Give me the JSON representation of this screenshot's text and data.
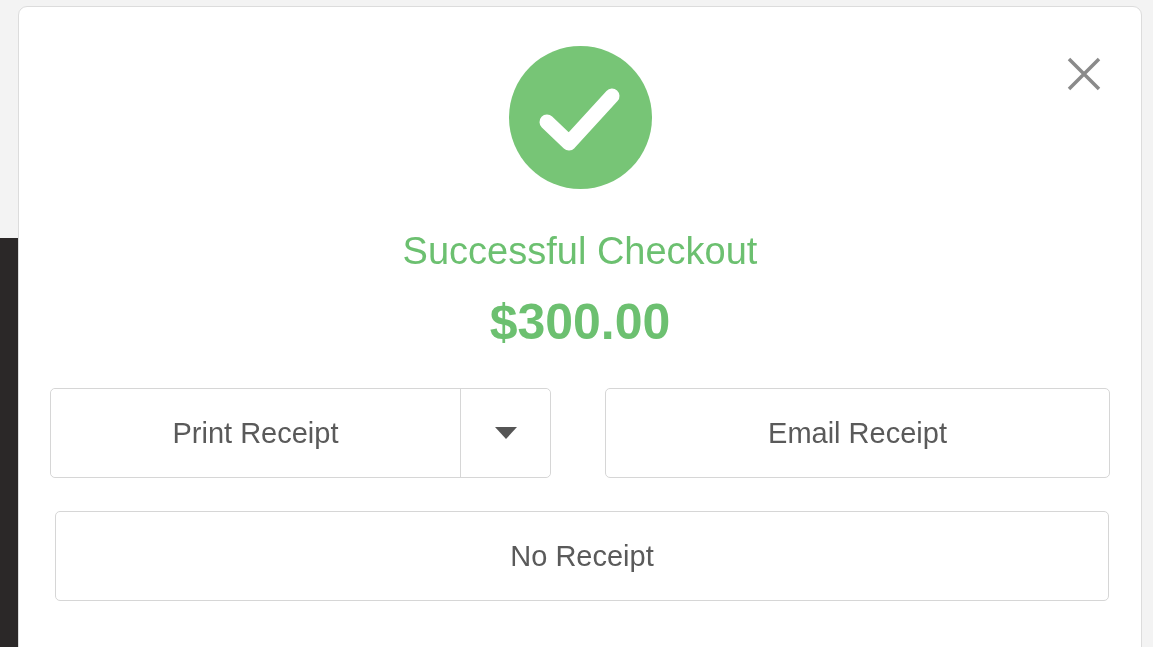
{
  "dialog": {
    "status": "Successful Checkout",
    "amount": "$300.00"
  },
  "buttons": [
    {
      "label": "Print Receipt",
      "kind": "split"
    },
    {
      "label": "Email Receipt",
      "kind": "plain"
    },
    {
      "label": "No Receipt",
      "kind": "wide"
    }
  ]
}
